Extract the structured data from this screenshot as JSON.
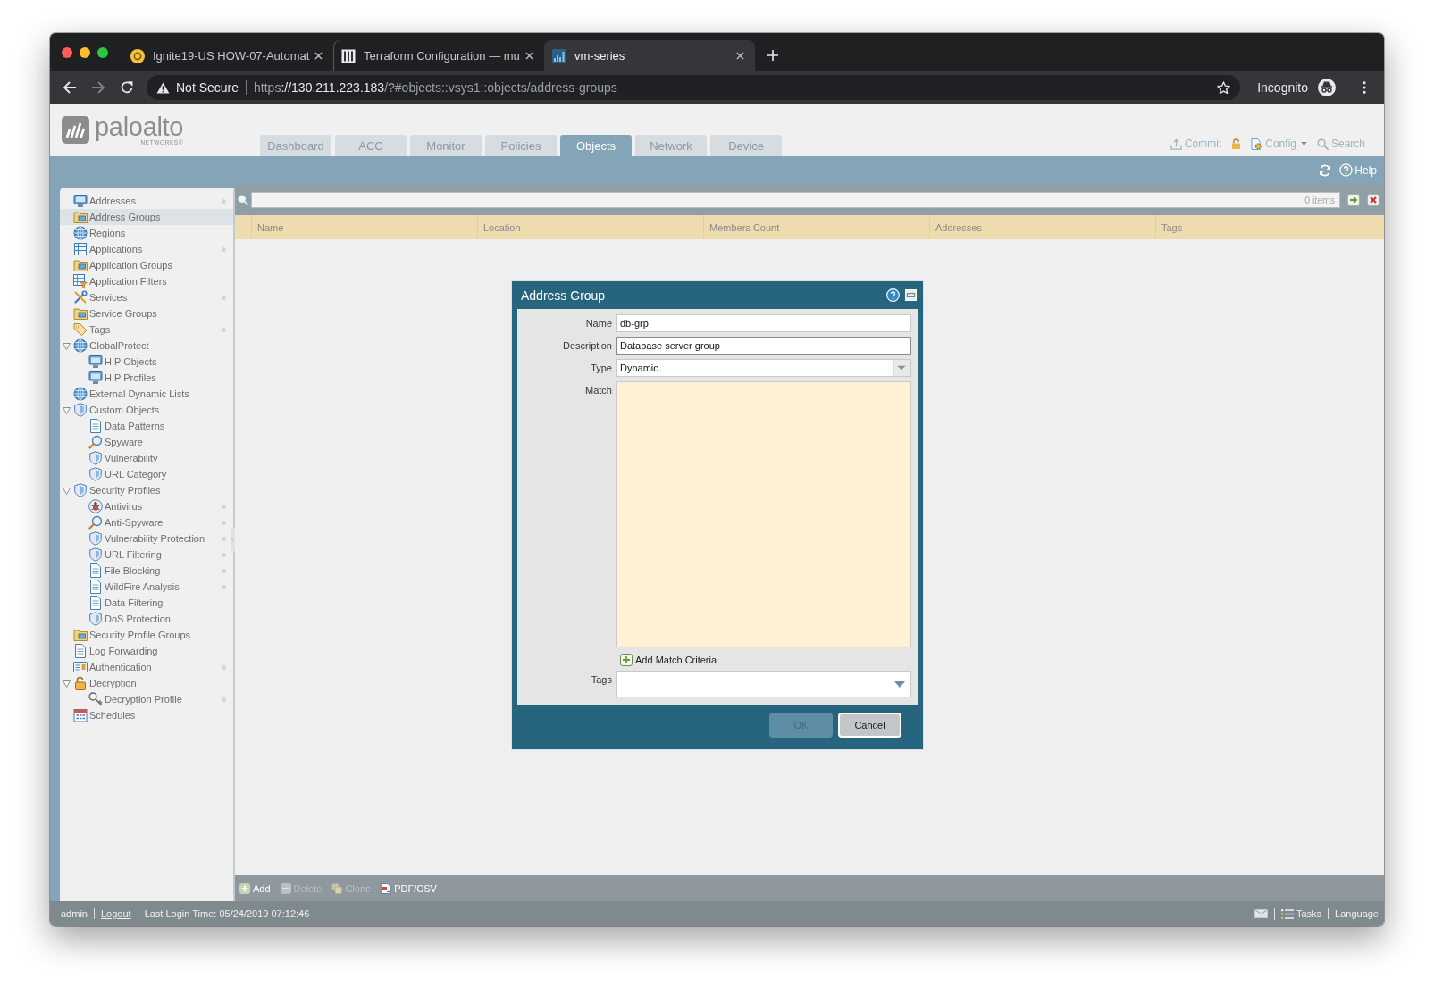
{
  "browser": {
    "tabs": [
      {
        "title": "Ignite19-US HOW-07-Automat",
        "selected": false
      },
      {
        "title": "Terraform Configuration — mu",
        "selected": false
      },
      {
        "title": "vm-series",
        "selected": true
      }
    ],
    "address_bar": {
      "security_label": "Not Secure",
      "insecure": true,
      "url_scheme": "https",
      "url_host": "://130.211.223.183",
      "url_path": "/?#objects::vsys1::objects/address-groups"
    },
    "profile_label": "Incognito"
  },
  "app": {
    "logo": {
      "wordmark": "paloalto",
      "tagline": "NETWORKS®"
    },
    "nav_tabs": [
      {
        "label": "Dashboard",
        "selected": false
      },
      {
        "label": "ACC",
        "selected": false
      },
      {
        "label": "Monitor",
        "selected": false
      },
      {
        "label": "Policies",
        "selected": false
      },
      {
        "label": "Objects",
        "selected": true
      },
      {
        "label": "Network",
        "selected": false
      },
      {
        "label": "Device",
        "selected": false
      }
    ],
    "header_actions": [
      {
        "kind": "commit",
        "label": "Commit"
      },
      {
        "kind": "lock"
      },
      {
        "kind": "config",
        "label": "Config"
      },
      {
        "kind": "search",
        "label": "Search"
      }
    ],
    "help_label": "Help"
  },
  "sidebar": {
    "items": [
      {
        "label": "Addresses",
        "selected": false,
        "dot": true
      },
      {
        "label": "Address Groups",
        "selected": true,
        "dot": false
      },
      {
        "label": "Regions",
        "selected": false,
        "dot": false
      },
      {
        "label": "Applications",
        "selected": false,
        "dot": true
      },
      {
        "label": "Application Groups",
        "selected": false,
        "dot": false
      },
      {
        "label": "Application Filters",
        "selected": false,
        "dot": false
      },
      {
        "label": "Services",
        "selected": false,
        "dot": true
      },
      {
        "label": "Service Groups",
        "selected": false,
        "dot": false
      },
      {
        "label": "Tags",
        "selected": false,
        "dot": true
      },
      {
        "label": "GlobalProtect",
        "selected": false,
        "dot": false,
        "expanded": true,
        "children": [
          {
            "label": "HIP Objects",
            "selected": false,
            "dot": false
          },
          {
            "label": "HIP Profiles",
            "selected": false,
            "dot": false
          }
        ]
      },
      {
        "label": "External Dynamic Lists",
        "selected": false,
        "dot": false
      },
      {
        "label": "Custom Objects",
        "selected": false,
        "dot": false,
        "expanded": true,
        "children": [
          {
            "label": "Data Patterns",
            "selected": false,
            "dot": false
          },
          {
            "label": "Spyware",
            "selected": false,
            "dot": false
          },
          {
            "label": "Vulnerability",
            "selected": false,
            "dot": false
          },
          {
            "label": "URL Category",
            "selected": false,
            "dot": false
          }
        ]
      },
      {
        "label": "Security Profiles",
        "selected": false,
        "dot": false,
        "expanded": true,
        "children": [
          {
            "label": "Antivirus",
            "selected": false,
            "dot": true
          },
          {
            "label": "Anti-Spyware",
            "selected": false,
            "dot": true
          },
          {
            "label": "Vulnerability Protection",
            "selected": false,
            "dot": true
          },
          {
            "label": "URL Filtering",
            "selected": false,
            "dot": true
          },
          {
            "label": "File Blocking",
            "selected": false,
            "dot": true
          },
          {
            "label": "WildFire Analysis",
            "selected": false,
            "dot": true
          },
          {
            "label": "Data Filtering",
            "selected": false,
            "dot": false
          },
          {
            "label": "DoS Protection",
            "selected": false,
            "dot": false
          }
        ]
      },
      {
        "label": "Security Profile Groups",
        "selected": false,
        "dot": false
      },
      {
        "label": "Log Forwarding",
        "selected": false,
        "dot": false
      },
      {
        "label": "Authentication",
        "selected": false,
        "dot": true
      },
      {
        "label": "Decryption",
        "selected": false,
        "dot": false,
        "expanded": true,
        "children": [
          {
            "label": "Decryption Profile",
            "selected": false,
            "dot": true
          }
        ]
      },
      {
        "label": "Schedules",
        "selected": false,
        "dot": false
      }
    ]
  },
  "filter": {
    "count": "0 items"
  },
  "table": {
    "columns": [
      "Name",
      "Location",
      "Members Count",
      "Addresses",
      "Tags"
    ]
  },
  "toolbar": {
    "buttons": [
      {
        "kind": "add",
        "label": "Add",
        "disabled": false
      },
      {
        "kind": "delete",
        "label": "Delete",
        "disabled": true
      },
      {
        "kind": "clone",
        "label": "Clone",
        "disabled": true
      },
      {
        "kind": "export",
        "label": "PDF/CSV",
        "disabled": false
      }
    ]
  },
  "status_bar": {
    "user": "admin",
    "logout": "Logout",
    "last_login": "Last Login Time: 05/24/2019 07:12:46",
    "tasks": "Tasks",
    "language": "Language"
  },
  "dialog": {
    "title": "Address Group",
    "fields": [
      {
        "kind": "text",
        "label": "Name",
        "value": "db-grp",
        "focused": false
      },
      {
        "kind": "text",
        "label": "Description",
        "value": "Database server group",
        "focused": true
      },
      {
        "kind": "select",
        "label": "Type",
        "value": "Dynamic"
      },
      {
        "kind": "match",
        "label": "Match",
        "action": "Add Match Criteria"
      },
      {
        "kind": "tags",
        "label": "Tags"
      }
    ],
    "buttons": [
      {
        "label": "OK",
        "disabled": true
      },
      {
        "label": "Cancel",
        "disabled": false
      }
    ]
  }
}
